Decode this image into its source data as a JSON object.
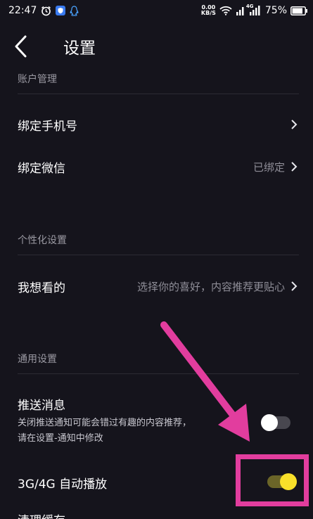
{
  "status_bar": {
    "time": "22:47",
    "net_speed_value": "0.00",
    "net_speed_unit": "KB/S",
    "battery_text": "75%",
    "net_type_label": "4G"
  },
  "header": {
    "title": "设置"
  },
  "sections": {
    "account": {
      "label": "账户管理",
      "bind_phone": {
        "label": "绑定手机号",
        "value": ""
      },
      "bind_wechat": {
        "label": "绑定微信",
        "value": "已绑定"
      }
    },
    "personal": {
      "label": "个性化设置",
      "interests": {
        "label": "我想看的",
        "value": "选择你的喜好，内容推荐更贴心"
      }
    },
    "general": {
      "label": "通用设置",
      "push": {
        "label": "推送消息",
        "desc_line1": "关闭推送通知可能会错过有趣的内容推荐，",
        "desc_line2": "请在设置-通知中修改",
        "enabled": false
      },
      "autoplay": {
        "label": "3G/4G 自动播放",
        "enabled": true
      },
      "next_partial": {
        "label": "清理缓存"
      }
    }
  },
  "colors": {
    "background": "#15141c",
    "toggle_on": "#f8e02a",
    "annotation": "#e23d9e"
  }
}
